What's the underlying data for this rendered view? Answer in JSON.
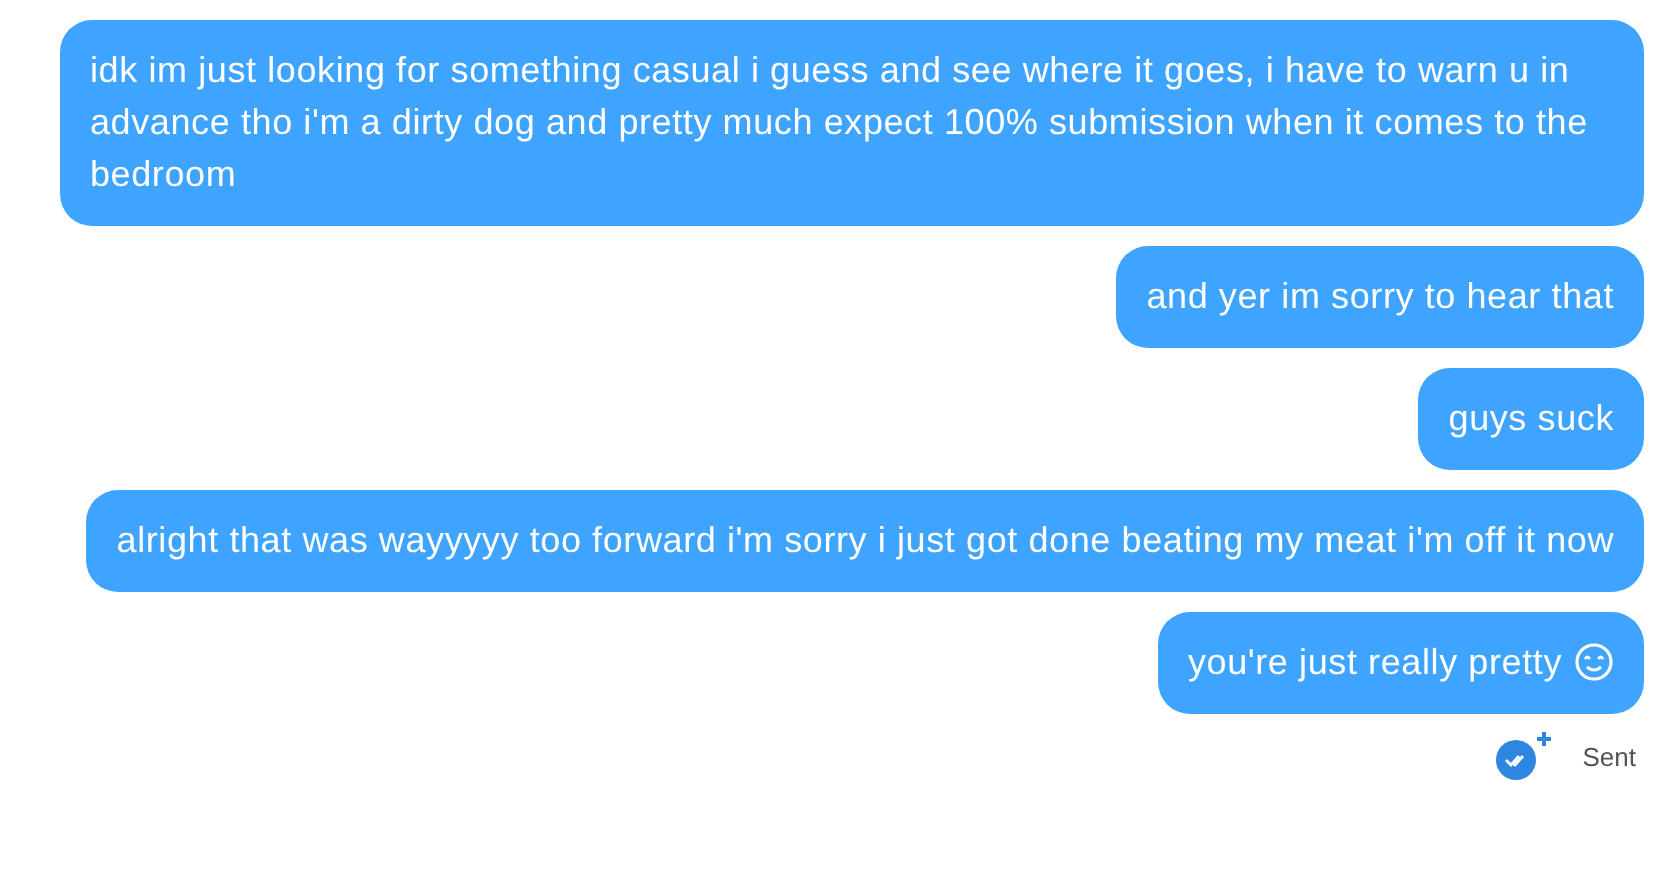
{
  "messages": [
    {
      "text": "idk im just looking for something casual i guess and see where it goes, i have to warn u in advance tho i'm a dirty dog and pretty much expect 100% submission when it comes to the bedroom",
      "emoji": false
    },
    {
      "text": "and yer im sorry to hear that",
      "emoji": false
    },
    {
      "text": "guys suck",
      "emoji": false
    },
    {
      "text": "alright that was wayyyyy too forward i'm sorry i just got done beating my meat i'm off it now",
      "emoji": false
    },
    {
      "text": "you're just really pretty",
      "emoji": true
    }
  ],
  "status": {
    "label": "Sent"
  }
}
